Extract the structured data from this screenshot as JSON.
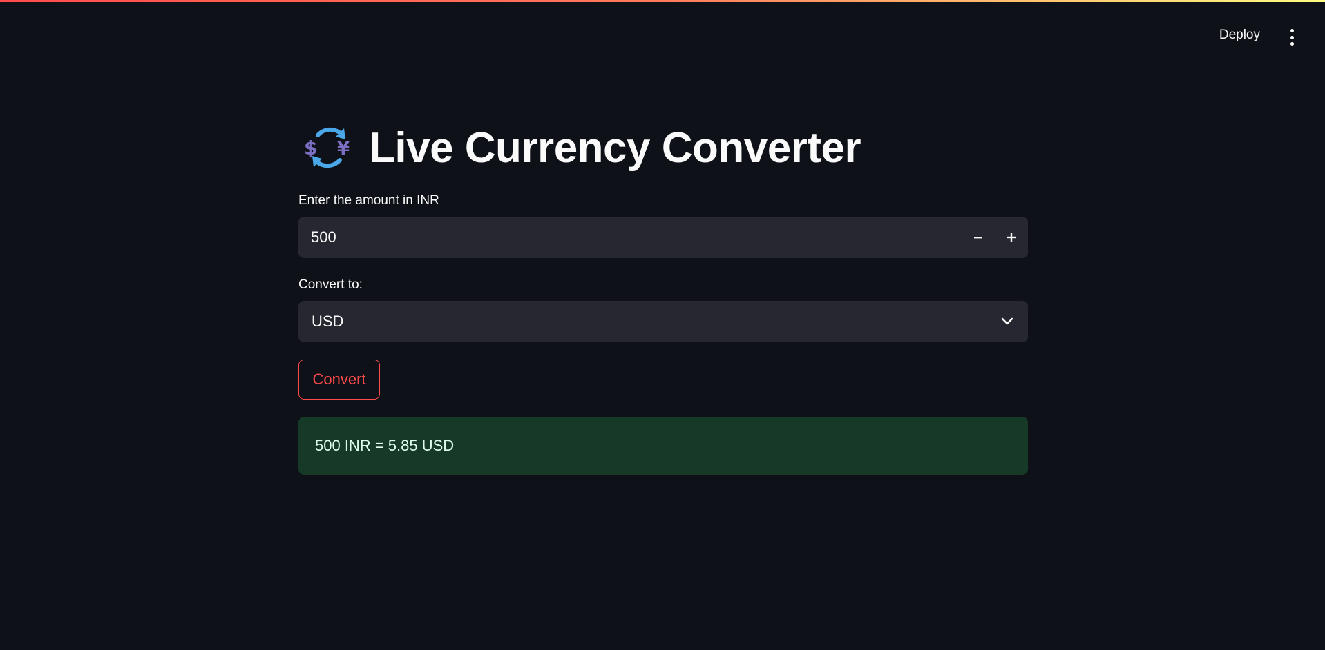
{
  "header": {
    "deploy_label": "Deploy",
    "menu_icon": "more-vertical-icon"
  },
  "title": {
    "icon": "currency-exchange-icon",
    "text": "Live Currency Converter"
  },
  "amount_field": {
    "label": "Enter the amount in INR",
    "value": "500",
    "decrement_icon": "minus-icon",
    "increment_icon": "plus-icon"
  },
  "target_currency": {
    "label": "Convert to:",
    "selected": "USD",
    "chevron_icon": "chevron-down-icon"
  },
  "convert_button": {
    "label": "Convert"
  },
  "result": {
    "text": "500 INR = 5.85 USD"
  },
  "colors": {
    "background": "#0e1117",
    "input_bg": "#262730",
    "accent": "#ff4b4b",
    "success_bg": "#173928",
    "success_text": "#dffde9",
    "icon_purple": "#7b6fc4",
    "icon_blue": "#4aa8e8"
  }
}
